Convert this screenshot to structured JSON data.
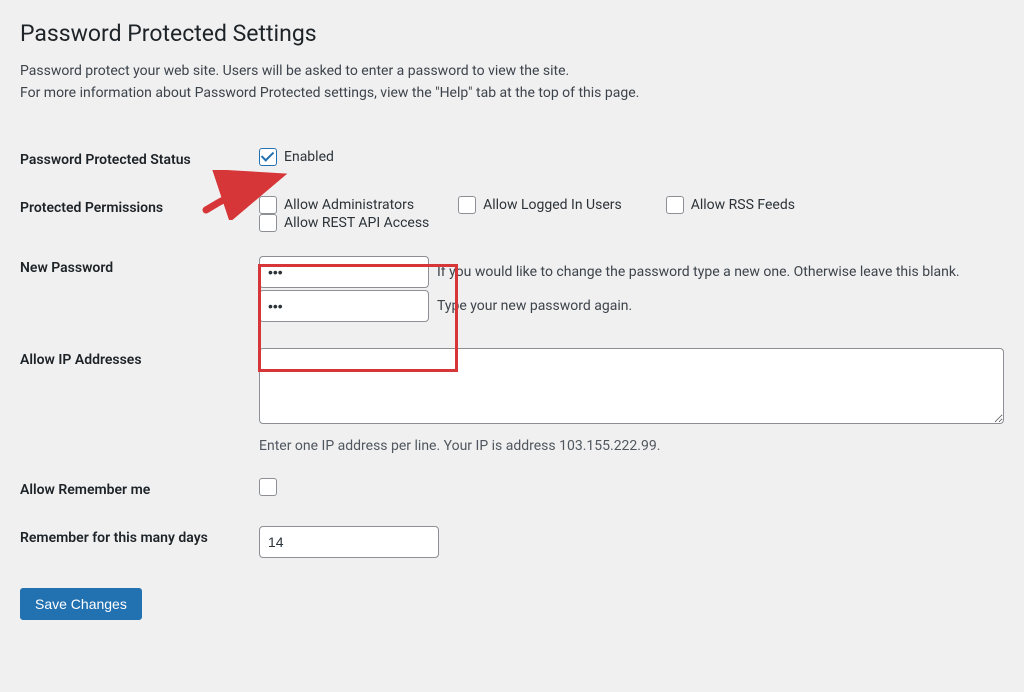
{
  "page": {
    "title": "Password Protected Settings",
    "description_line1": "Password protect your web site. Users will be asked to enter a password to view the site.",
    "description_line2": "For more information about Password Protected settings, view the \"Help\" tab at the top of this page."
  },
  "status": {
    "label": "Password Protected Status",
    "enabled_label": "Enabled",
    "checked": true
  },
  "permissions": {
    "label": "Protected Permissions",
    "options": [
      {
        "label": "Allow Administrators",
        "checked": false
      },
      {
        "label": "Allow Logged In Users",
        "checked": false
      },
      {
        "label": "Allow RSS Feeds",
        "checked": false
      },
      {
        "label": "Allow REST API Access",
        "checked": false
      }
    ]
  },
  "new_password": {
    "label": "New Password",
    "value": "•••",
    "hint1": "If you would like to change the password type a new one. Otherwise leave this blank.",
    "confirm_value": "•••",
    "hint2": "Type your new password again."
  },
  "allow_ip": {
    "label": "Allow IP Addresses",
    "value": "",
    "hint": "Enter one IP address per line. Your IP is address 103.155.222.99."
  },
  "remember_me": {
    "label": "Allow Remember me",
    "checked": false
  },
  "remember_days": {
    "label": "Remember for this many days",
    "value": "14"
  },
  "submit": {
    "label": "Save Changes"
  }
}
